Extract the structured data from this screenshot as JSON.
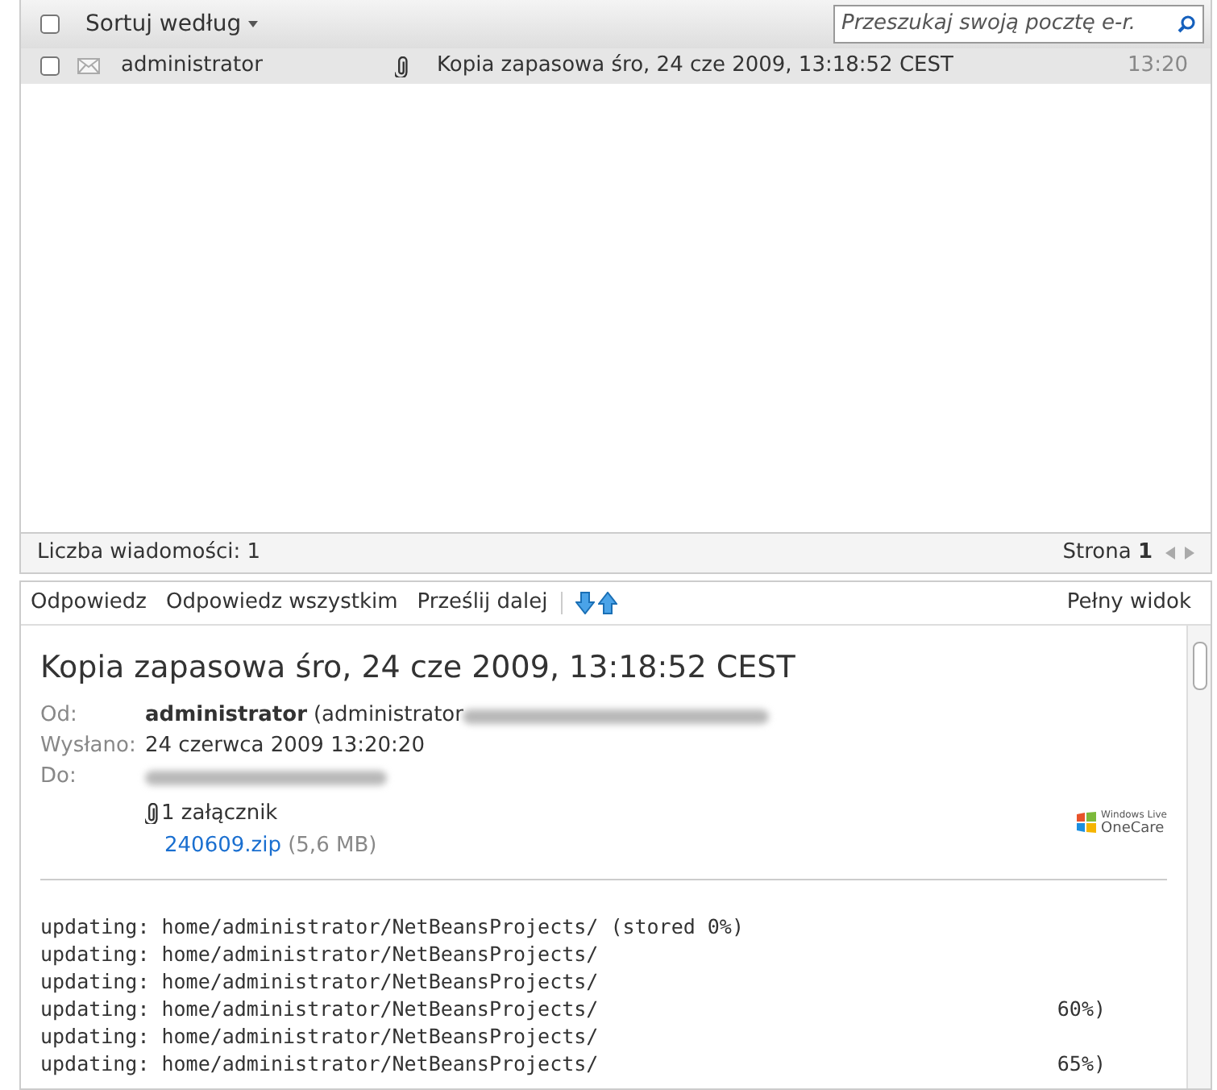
{
  "list_header": {
    "select_all_checked": false,
    "sort_label": "Sortuj według",
    "search": {
      "placeholder": "Przeszukaj swoją pocztę e-r."
    }
  },
  "messages": [
    {
      "checked": false,
      "selected": true,
      "sender": "administrator",
      "has_attachment": true,
      "subject": "Kopia zapasowa śro, 24 cze 2009, 13:18:52 CEST",
      "time": "13:20"
    }
  ],
  "list_footer": {
    "count": "Liczba wiadomości: 1",
    "page_label": "Strona",
    "page": "1"
  },
  "toolbar": {
    "actions": [
      "Odpowiedz",
      "Odpowiedz wszystkim",
      "Prześlij dalej"
    ],
    "full_view": "Pełny widok"
  },
  "message": {
    "subject": "Kopia zapasowa śro, 24 cze 2009, 13:18:52 CEST",
    "fields": [
      {
        "label": "Od:",
        "name": "administrator",
        "value": "(administrator"
      },
      {
        "label": "Wysłano:",
        "value": "24 czerwca 2009 13:20:20"
      },
      {
        "label": "Do:"
      }
    ],
    "attachment_count": "1 załącznik",
    "attachment": {
      "file": "240609.zip",
      "size": "(5,6 MB)"
    },
    "logo": [
      "Windows Live",
      "OneCare"
    ],
    "body": [
      {
        "left": "updating: home/administrator/NetBeansProjects/ (stored 0%)"
      },
      {
        "left": "updating: home/administrator/NetBeansProjects/"
      },
      {
        "left": "updating: home/administrator/NetBeansProjects/"
      },
      {
        "left": "updating: home/administrator/NetBeansProjects/",
        "right": "60%)"
      },
      {
        "left": "updating: home/administrator/NetBeansProjects/"
      },
      {
        "left": "updating: home/administrator/NetBeansProjects/",
        "right": "65%)"
      }
    ]
  }
}
